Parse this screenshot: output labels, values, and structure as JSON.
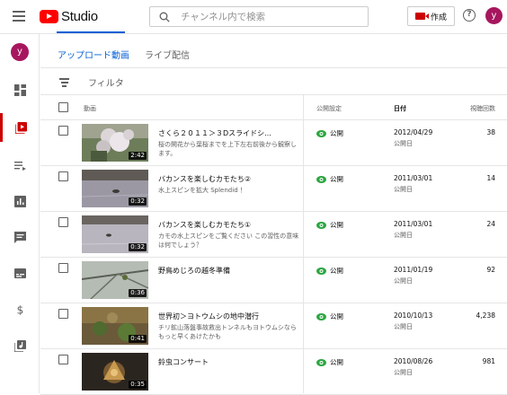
{
  "app": {
    "logo_text": "Studio"
  },
  "search": {
    "placeholder": "チャンネル内で検索"
  },
  "header": {
    "create_label": "作成",
    "avatar_letter": "y"
  },
  "sidebar": {
    "avatar_letter": "y",
    "items": [
      {
        "icon": "dashboard-icon"
      },
      {
        "icon": "content-icon",
        "active": true
      },
      {
        "icon": "playlists-icon"
      },
      {
        "icon": "analytics-icon"
      },
      {
        "icon": "comments-icon"
      },
      {
        "icon": "subtitles-icon"
      },
      {
        "icon": "monetization-icon"
      },
      {
        "icon": "audio-library-icon"
      }
    ]
  },
  "tabs": [
    {
      "label": "アップロード動画",
      "active": true
    },
    {
      "label": "ライブ配信",
      "active": false
    }
  ],
  "filter": {
    "label": "フィルタ"
  },
  "table": {
    "headers": {
      "video": "動画",
      "visibility": "公開設定",
      "date": "日付",
      "views": "視聴回数"
    },
    "rows": [
      {
        "title": "さくら２０１１＞３Dスライドシ...",
        "description": "桜の開花から葉桜までを上下左右前後から観察します。",
        "duration": "2:42",
        "visibility": "公開",
        "date": "2012/04/29",
        "date_label": "公開日",
        "views": "38"
      },
      {
        "title": "バカンスを楽しむカモたち②",
        "description": "水上スピンを拡大 Splendid ！",
        "duration": "0:32",
        "visibility": "公開",
        "date": "2011/03/01",
        "date_label": "公開日",
        "views": "14"
      },
      {
        "title": "バカンスを楽しむカモたち①",
        "description": "カモの水上スピンをご覧ください この習性の意味は何でしょう？",
        "duration": "0:32",
        "visibility": "公開",
        "date": "2011/03/01",
        "date_label": "公開日",
        "views": "24"
      },
      {
        "title": "野鳥めじろの越冬準備",
        "description": "",
        "duration": "0:36",
        "visibility": "公開",
        "date": "2011/01/19",
        "date_label": "公開日",
        "views": "92"
      },
      {
        "title": "世界初＞ヨトウムシの地中潜行",
        "description": "チリ鉱山落盤事故救出トンネルもヨトウムシならもっと早くあけたかも",
        "duration": "0:41",
        "visibility": "公開",
        "date": "2010/10/13",
        "date_label": "公開日",
        "views": "4,238"
      },
      {
        "title": "鈴虫コンサート",
        "description": "",
        "duration": "0:35",
        "visibility": "公開",
        "date": "2010/08/26",
        "date_label": "公開日",
        "views": "981"
      }
    ]
  },
  "colors": {
    "accent": "#065fd4",
    "brand": "#ff0000",
    "visibility_icon": "#2ba640",
    "avatar": "#a6165e"
  }
}
